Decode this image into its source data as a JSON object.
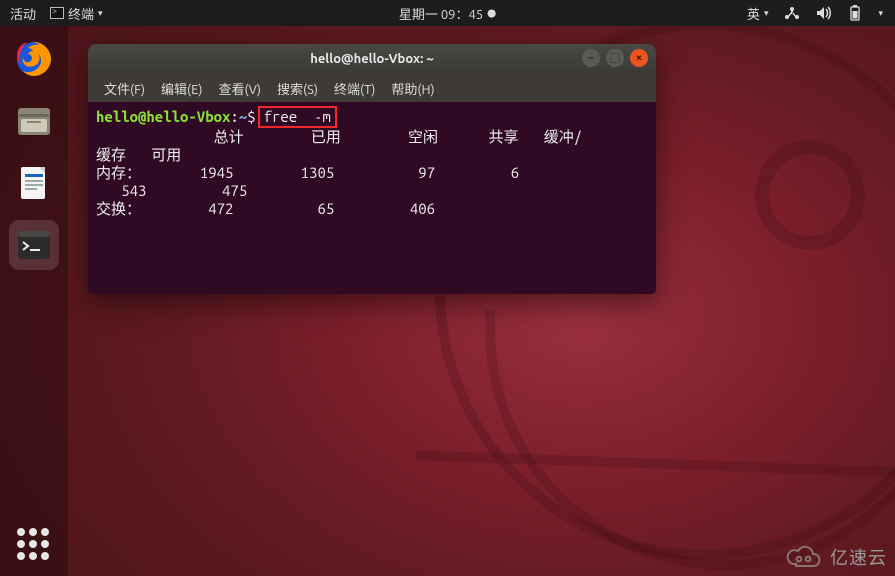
{
  "topbar": {
    "activities": "活动",
    "app_label": "终端",
    "app_dropdown_glyph": "▾",
    "clock": "星期一 09：45",
    "clock_dot": "●",
    "ime": "英",
    "ime_dropdown_glyph": "▾"
  },
  "dock": {
    "items": [
      {
        "name": "firefox"
      },
      {
        "name": "files"
      },
      {
        "name": "writer"
      },
      {
        "name": "terminal"
      }
    ]
  },
  "terminal": {
    "title": "hello@hello-Vbox: ~",
    "menu": [
      "文件(F)",
      "编辑(E)",
      "查看(V)",
      "搜索(S)",
      "终端(T)",
      "帮助(H)"
    ],
    "prompt": {
      "user_host": "hello@hello-Vbox",
      "colon": ":",
      "path": "~",
      "sigil": "$"
    },
    "command": "free  -m",
    "headers": {
      "total": "总计",
      "used": "已用",
      "free": "空闲",
      "shared": "共享",
      "buffcache_a": "缓冲/",
      "buffcache_b": "缓存",
      "available": "可用"
    },
    "rows": {
      "mem_label": "内存：",
      "mem": {
        "total": "1945",
        "used": "1305",
        "free": "97",
        "shared": "6",
        "buffcache": "543",
        "available": "475"
      },
      "swap_label": "交换：",
      "swap": {
        "total": "472",
        "used": "65",
        "free": "406"
      }
    }
  },
  "watermark": {
    "text": "亿速云"
  }
}
